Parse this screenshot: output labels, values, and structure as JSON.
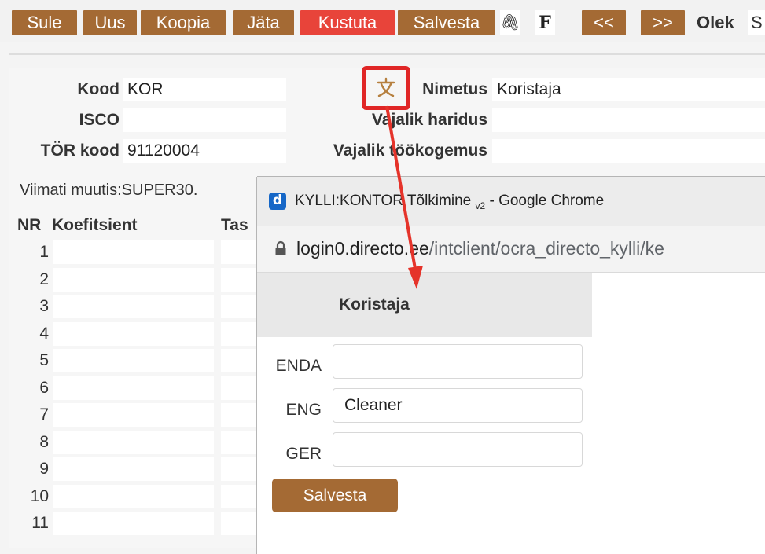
{
  "toolbar": {
    "buttons": [
      "Sule",
      "Uus",
      "Koopia",
      "Jäta",
      "Kustuta",
      "Salvesta"
    ],
    "attach_glyph": "🖇",
    "f_glyph": "F",
    "prev_label": "<<",
    "next_label": ">>",
    "olek_label": "Olek",
    "olek_value": "S"
  },
  "form": {
    "kood_label": "Kood",
    "kood_value": "KOR",
    "isco_label": "ISCO",
    "isco_value": "",
    "tor_label": "TÖR kood",
    "tor_value": "91120004",
    "nimetus_label": "Nimetus",
    "nimetus_value": "Koristaja",
    "haridus_label": "Vajalik haridus",
    "haridus_value": "",
    "kogemus_label": "Vajalik töökogemus",
    "kogemus_value": "",
    "modified": "Viimati muutis:SUPER30."
  },
  "table": {
    "col_nr": "NR",
    "col_koef": "Koefitsient",
    "col_tas": "Tas",
    "rows": [
      "1",
      "2",
      "3",
      "4",
      "5",
      "6",
      "7",
      "8",
      "9",
      "10",
      "11"
    ]
  },
  "popup": {
    "window_title": "KYLLI:KONTOR Tõlkimine",
    "window_title_sub": "v2",
    "window_title_suffix": " - Google Chrome",
    "favicon_letter": "d",
    "url_host": "login0.directo.ee",
    "url_path": "/intclient/ocra_directo_kylli/ke",
    "header": "Koristaja",
    "langs": [
      {
        "code": "ENDA",
        "value": ""
      },
      {
        "code": "ENG",
        "value": "Cleaner"
      },
      {
        "code": "GER",
        "value": ""
      }
    ],
    "save_label": "Salvesta"
  },
  "colors": {
    "button_brown": "#a46a34",
    "button_red": "#e8443a",
    "highlight_red": "#e02626"
  }
}
